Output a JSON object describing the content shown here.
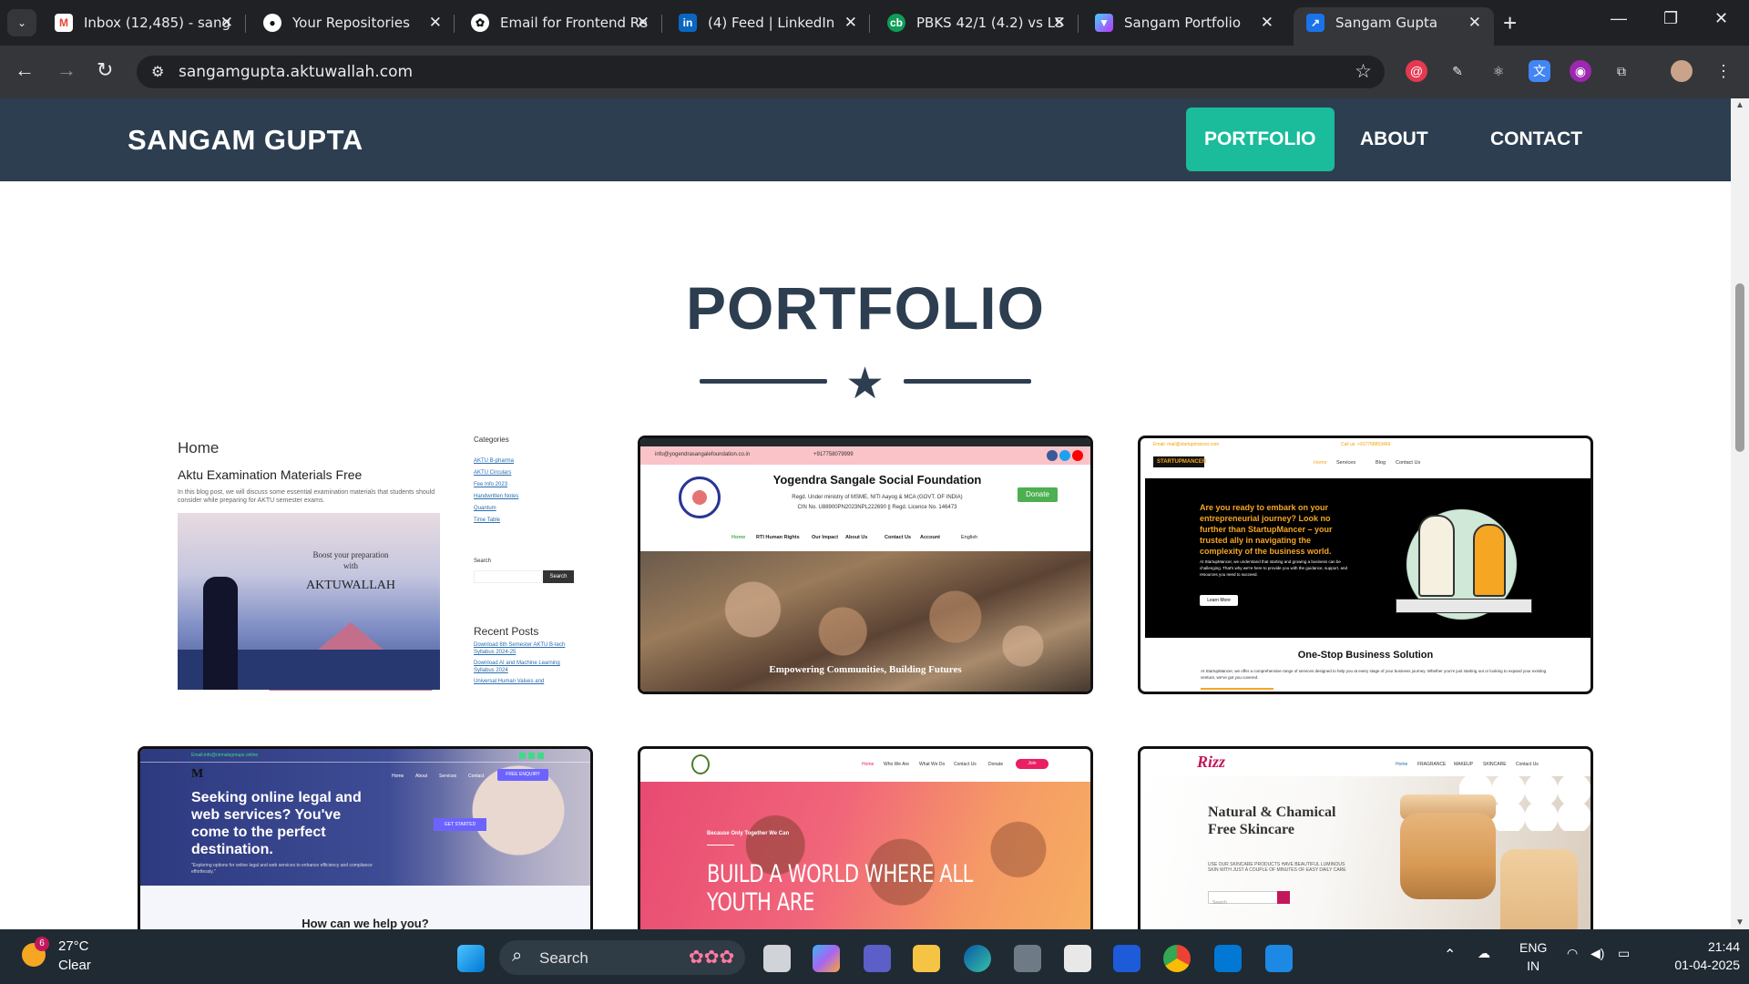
{
  "browser": {
    "tabs": [
      {
        "title": "Inbox (12,485) - sang",
        "icon": "gmail-icon"
      },
      {
        "title": "Your Repositories",
        "icon": "github-icon"
      },
      {
        "title": "Email for Frontend Re",
        "icon": "openai-icon"
      },
      {
        "title": "(4) Feed | LinkedIn",
        "icon": "linkedin-icon"
      },
      {
        "title": "PBKS 42/1 (4.2) vs LS",
        "icon": "cricbuzz-icon"
      },
      {
        "title": "Sangam Portfolio",
        "icon": "vite-icon"
      },
      {
        "title": "Sangam Gupta",
        "icon": "link-icon"
      }
    ],
    "active_tab_index": 6,
    "url": "sangamgupta.aktuwallah.com"
  },
  "site": {
    "brand": "SANGAM GUPTA",
    "nav": [
      {
        "label": "PORTFOLIO",
        "active": true
      },
      {
        "label": "ABOUT",
        "active": false
      },
      {
        "label": "CONTACT",
        "active": false
      }
    ],
    "section_title": "PORTFOLIO"
  },
  "cards": {
    "aktuwallah": {
      "home": "Home",
      "post_title": "Aktu Examination Materials Free",
      "post_text": "In this blog post, we will discuss some essential examination materials that students should consider while preparing for AKTU semester exams.",
      "hero_line1": "Boost your preparation",
      "hero_line2": "with",
      "hero_brand": "AKTUWALLAH",
      "categories_heading": "Categories",
      "categories": [
        "AKTU B-pharma",
        "AKTU Circulars",
        "Fee Info 2023",
        "Handwritten Notes",
        "Quantum",
        "Time Table"
      ],
      "search_label": "Search",
      "search_button": "Search",
      "recent_heading": "Recent Posts",
      "recent": [
        "Download 6th Semester AKTU B-tech Syllabus 2024-25",
        "Download AI and Machine Learning Syllabus 2024",
        "Universal Human Values and"
      ]
    },
    "foundation": {
      "email": "info@yogendrasangalefoundation.co.in",
      "phone": "+917758079999",
      "org": "Yogendra Sangale Social Foundation",
      "reg1": "Regd. Under ministry of MSME, NITI Aayog & MCA (GOVT. OF INDIA)",
      "reg2": "CIN No. U88900PN2023NPL222690 || Regd. Licence No. 146473",
      "donate": "Donate",
      "menu": [
        "Home",
        "RTI Human Rights",
        "Our Impact",
        "About Us",
        "Contact Us",
        "Account",
        "English"
      ],
      "caption": "Empowering Communities, Building Futures"
    },
    "startupmancer": {
      "email": "Email: mail@startupmancer.com",
      "call": "Call us: +917768853466",
      "logo": "STARTUPMANCER",
      "nav": [
        "Home",
        "Services",
        "Blog",
        "Contact Us"
      ],
      "headline": "Are you ready to embark on your entrepreneurial journey? Look no further than StartupMancer – your trusted ally in navigating the complexity of the business world.",
      "sub": "At StartupMancer, we understand that starting and growing a business can be challenging. That's why we're here to provide you with the guidance, support, and resources you need to succeed.",
      "learn_more": "Learn More",
      "section_title": "One-Stop Business Solution",
      "section_text": "At StartupMancer, we offer a comprehensive range of services designed to help you at every stage of your business journey. Whether you're just starting out or looking to expand your existing venture, we've got you covered."
    },
    "legal": {
      "email": "Email:info@nirmalsgroups.online",
      "nav": [
        "Home",
        "About",
        "Services",
        "Contact"
      ],
      "free_enquiry": "FREE ENQUIRY",
      "headline": "Seeking online legal and web services? You've come to the perfect destination.",
      "sub": "\"Exploring options for online legal and web services to enhance efficiency and compliance effortlessly.\"",
      "get_started": "GET STARTED",
      "question": "How can we help you?"
    },
    "youth": {
      "nav": [
        "Home",
        "Who We Are",
        "What We Do",
        "Contact Us",
        "Donate"
      ],
      "pill": "Join",
      "kicker": "Because Only Together We Can",
      "headline": "BUILD A WORLD WHERE ALL YOUTH ARE"
    },
    "rizz": {
      "logo": "Rizz",
      "nav": [
        "Home",
        "FRAGRANCE",
        "MAKEUP",
        "SKINCARE",
        "Contact Us"
      ],
      "headline": "Natural & Chamical Free Skincare",
      "sub": "USE OUR SKINCARE PRODUCTS HAVE BEAUTIFUL LUMINOUS SKIN WITH JUST A COUPLE OF MINUTES OF EASY DAILY CARE",
      "search_placeholder": "Search"
    }
  },
  "taskbar": {
    "temperature": "27°C",
    "condition": "Clear",
    "weather_badge": "6",
    "search": "Search",
    "language": "ENG",
    "region": "IN",
    "time": "21:44",
    "date": "01-04-2025"
  }
}
